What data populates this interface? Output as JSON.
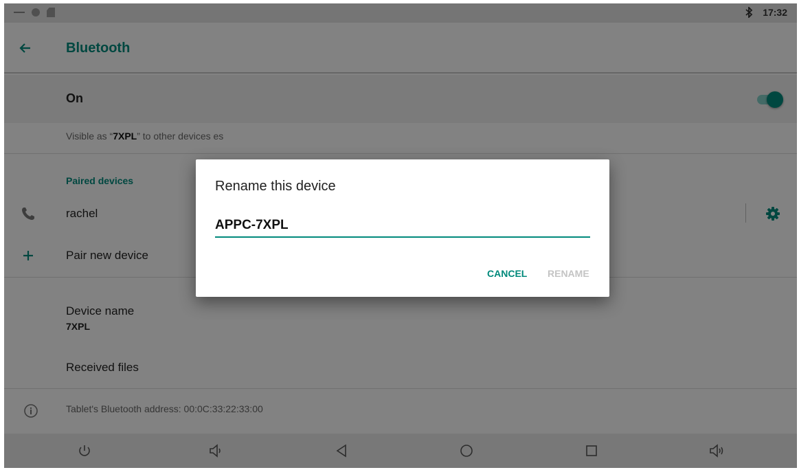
{
  "status_bar": {
    "time": "17:32",
    "bluetooth_icon": "bluetooth-icon"
  },
  "app_bar": {
    "title": "Bluetooth",
    "back_icon": "arrow-back-icon"
  },
  "toggle_row": {
    "label": "On",
    "state": "on"
  },
  "visibility": {
    "prefix": "Visible as “",
    "device": "7XPL",
    "suffix": "” to other devices",
    "trailing": "es"
  },
  "paired": {
    "header": "Paired devices",
    "devices": [
      {
        "name": "rachel",
        "icon": "phone-icon",
        "settings_icon": "gear-icon"
      }
    ],
    "pair_new": {
      "label": "Pair new device",
      "icon": "plus-icon"
    }
  },
  "device_name": {
    "title": "Device name",
    "value": "7XPL"
  },
  "received_files": {
    "label": "Received files"
  },
  "address": {
    "text": "Tablet's Bluetooth address: 00:0C:33:22:33:00",
    "icon": "info-icon"
  },
  "dialog": {
    "title": "Rename this device",
    "input_value": "APPC-7XPL",
    "cancel_label": "CANCEL",
    "rename_label": "RENAME"
  },
  "nav_bar": {
    "buttons": [
      "power-icon",
      "volume-down-icon",
      "back-icon",
      "home-icon",
      "recents-icon",
      "volume-up-icon"
    ]
  },
  "colors": {
    "accent": "#00897b",
    "disabled": "#c4c4c4"
  }
}
